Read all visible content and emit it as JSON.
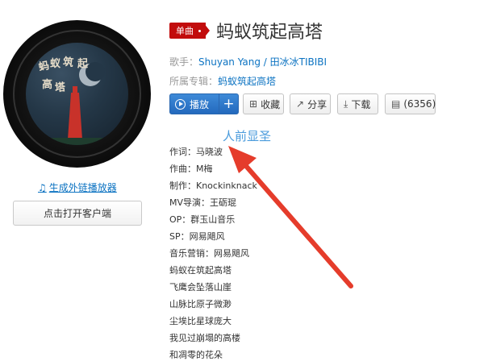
{
  "song": {
    "tag": "单曲",
    "title": "蚂蚁筑起高塔",
    "singer_label": "歌手：",
    "singers": [
      "Shuyan Yang",
      "田冰冰TIBIBI"
    ],
    "singer_sep": " / ",
    "album_label": "所属专辑：",
    "album": "蚂蚁筑起高塔"
  },
  "actions": {
    "play": "播放",
    "add": "+",
    "collect": "收藏",
    "share": "分享",
    "download": "下载",
    "comment": "(6356)"
  },
  "left": {
    "external_player": "生成外链播放器",
    "open_client": "点击打开客户端"
  },
  "cover": {
    "art_text": "蚂蚁筑起高塔"
  },
  "lyrics": {
    "head": "人前显圣",
    "lines": [
      "作词：马晓波",
      "作曲：M梅",
      "制作：Knockinknack",
      "MV导演：王砺琨",
      "OP：群玉山音乐",
      "SP：网易飓风",
      "音乐营销：网易飓风",
      "蚂蚁在筑起高塔",
      "飞鹰会坠落山崖",
      "山脉比原子微渺",
      "尘埃比星球庞大",
      "我见过崩塌的高楼",
      "和凋零的花朵"
    ]
  },
  "colors": {
    "accent_blue": "#2369bd",
    "link_blue": "#0c73c2",
    "tag_red": "#c20c0c",
    "annotation_red": "#e53c2b"
  },
  "icons": [
    "music-note-icon",
    "play-circle-icon",
    "plus-icon",
    "collect-icon",
    "share-icon",
    "download-icon",
    "comment-icon"
  ]
}
